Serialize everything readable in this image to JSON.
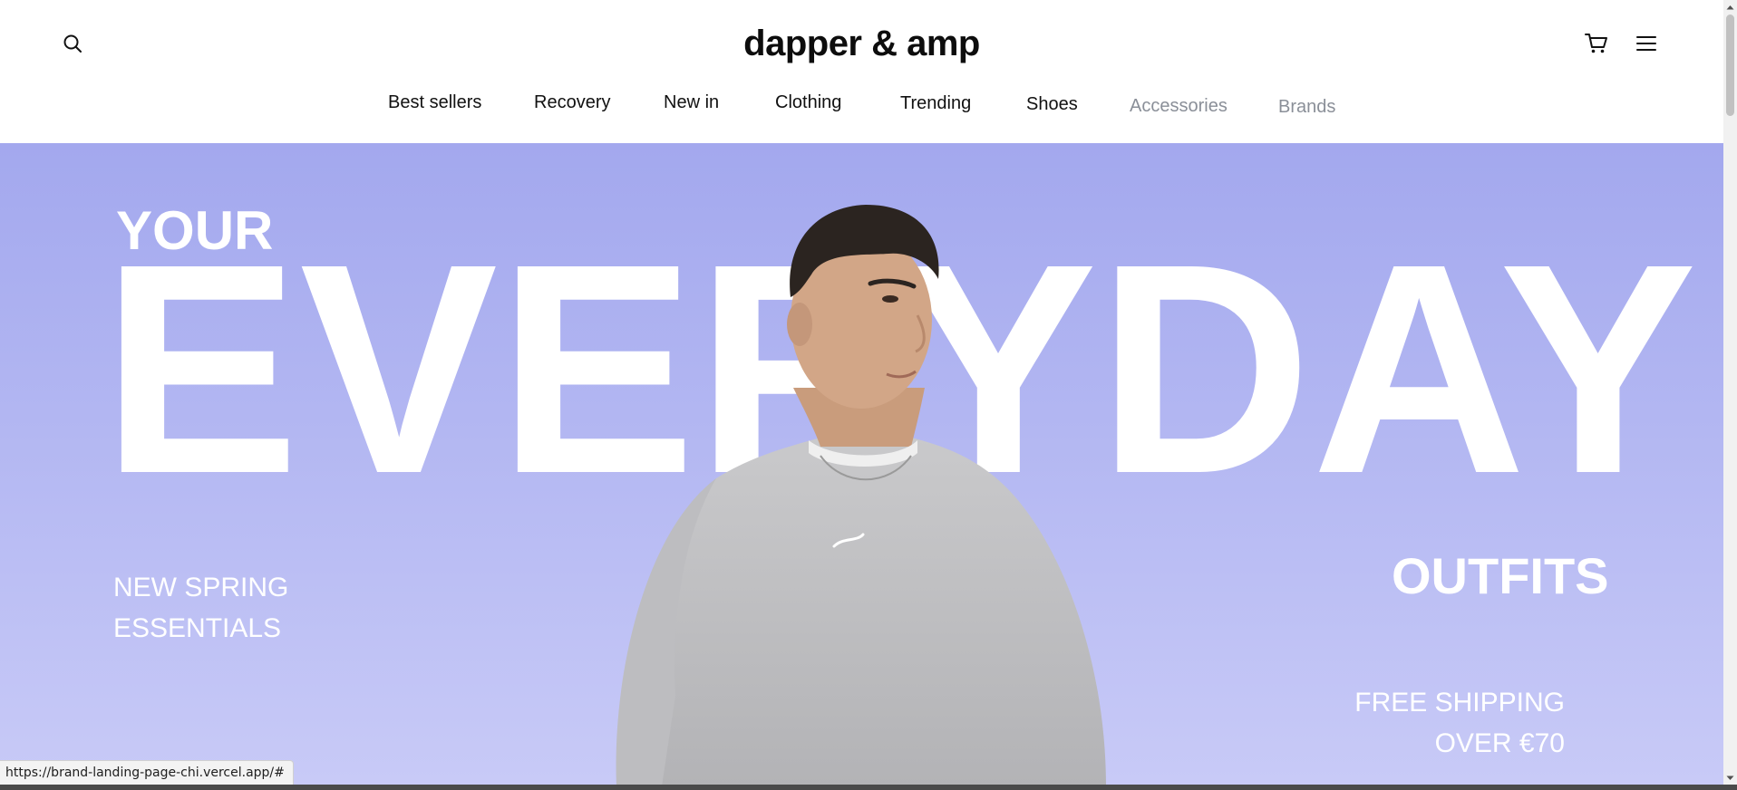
{
  "header": {
    "logo": "dapper & amp",
    "search_icon": "search-icon",
    "cart_icon": "cart-icon",
    "menu_icon": "hamburger-menu-icon"
  },
  "nav": {
    "items": [
      {
        "label": "Best sellers",
        "muted": false
      },
      {
        "label": "Recovery",
        "muted": false
      },
      {
        "label": "New in",
        "muted": false
      },
      {
        "label": "Clothing",
        "muted": false
      },
      {
        "label": "Trending",
        "muted": false
      },
      {
        "label": "Shoes",
        "muted": false
      },
      {
        "label": "Accessories",
        "muted": true
      },
      {
        "label": "Brands",
        "muted": true
      }
    ]
  },
  "hero": {
    "headline_small": "YOUR",
    "headline_big": "EVERYDAY",
    "subline": "OUTFITS",
    "promo_line1": "NEW SPRING",
    "promo_line2": "ESSENTIALS",
    "shipping_line1": "FREE SHIPPING",
    "shipping_line2": "OVER €70",
    "background_top": "#a3a8ee",
    "background_bottom": "#c8caf7"
  },
  "status_bar": {
    "url": "https://brand-landing-page-chi.vercel.app/#"
  }
}
